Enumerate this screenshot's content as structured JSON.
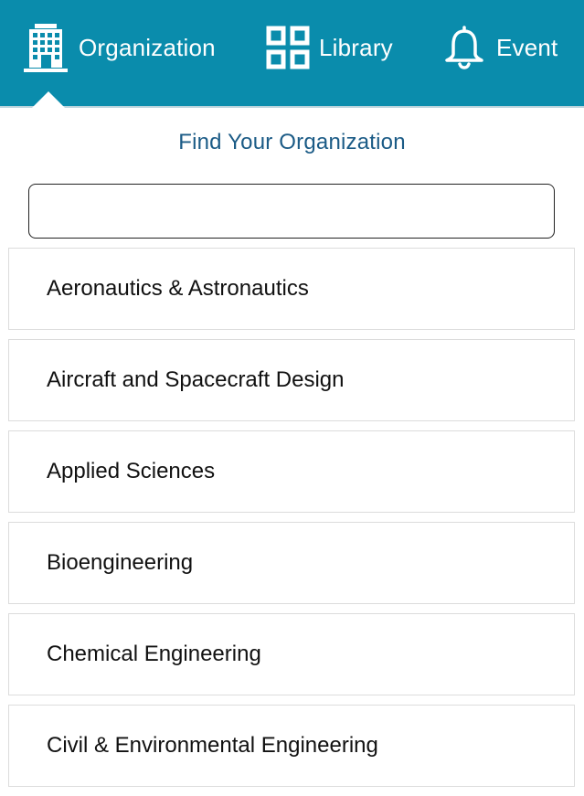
{
  "nav": {
    "items": [
      {
        "label": "Organization",
        "icon": "building-icon"
      },
      {
        "label": "Library",
        "icon": "grid-icon"
      },
      {
        "label": "Event",
        "icon": "bell-icon"
      }
    ],
    "active": "Organization",
    "background_color": "#0a8cac"
  },
  "panel": {
    "title": "Find Your Organization",
    "search": {
      "value": "",
      "placeholder": ""
    }
  },
  "organizations": [
    "Aeronautics & Astronautics",
    "Aircraft and Spacecraft Design",
    "Applied Sciences",
    "Bioengineering",
    "Chemical Engineering",
    "Civil & Environmental Engineering"
  ]
}
